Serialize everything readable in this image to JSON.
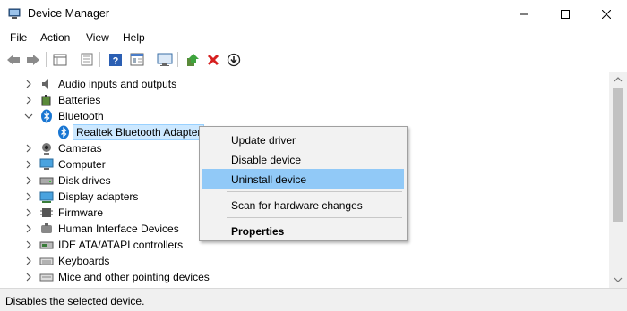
{
  "window": {
    "title": "Device Manager"
  },
  "menubar": {
    "items": [
      "File",
      "Action",
      "View",
      "Help"
    ]
  },
  "toolbar": {
    "icons": [
      "back-icon",
      "forward-icon",
      "properties-pane-icon",
      "show-hidden-icon",
      "help-icon",
      "details-icon",
      "monitor-icon",
      "update-driver-icon",
      "uninstall-icon",
      "download-icon"
    ]
  },
  "tree": {
    "nodes": [
      {
        "label": "Audio inputs and outputs",
        "icon": "speaker-icon",
        "expanded": false
      },
      {
        "label": "Batteries",
        "icon": "battery-icon",
        "expanded": false
      },
      {
        "label": "Bluetooth",
        "icon": "bluetooth-icon",
        "expanded": true
      },
      {
        "label": "Realtek Bluetooth Adapter",
        "icon": "bluetooth-icon",
        "child": true,
        "selected": true
      },
      {
        "label": "Cameras",
        "icon": "camera-icon",
        "expanded": false
      },
      {
        "label": "Computer",
        "icon": "computer-icon",
        "expanded": false
      },
      {
        "label": "Disk drives",
        "icon": "disk-icon",
        "expanded": false
      },
      {
        "label": "Display adapters",
        "icon": "display-icon",
        "expanded": false
      },
      {
        "label": "Firmware",
        "icon": "firmware-icon",
        "expanded": false
      },
      {
        "label": "Human Interface Devices",
        "icon": "hid-icon",
        "expanded": false
      },
      {
        "label": "IDE ATA/ATAPI controllers",
        "icon": "ide-icon",
        "expanded": false
      },
      {
        "label": "Keyboards",
        "icon": "keyboard-icon",
        "expanded": false
      },
      {
        "label": "Mice and other pointing devices",
        "icon": "mouse-icon",
        "expanded": false
      }
    ]
  },
  "context_menu": {
    "items": [
      {
        "label": "Update driver"
      },
      {
        "label": "Disable device"
      },
      {
        "label": "Uninstall device",
        "highlighted": true
      },
      {
        "label": "Scan for hardware changes"
      },
      {
        "label": "Properties",
        "bold": true
      }
    ]
  },
  "status": {
    "text": "Disables the selected device."
  },
  "colors": {
    "highlight": "#91c9f7",
    "selection": "#cce8ff",
    "menu_bg": "#f2f2f2",
    "status_bg": "#f0f0f0"
  }
}
